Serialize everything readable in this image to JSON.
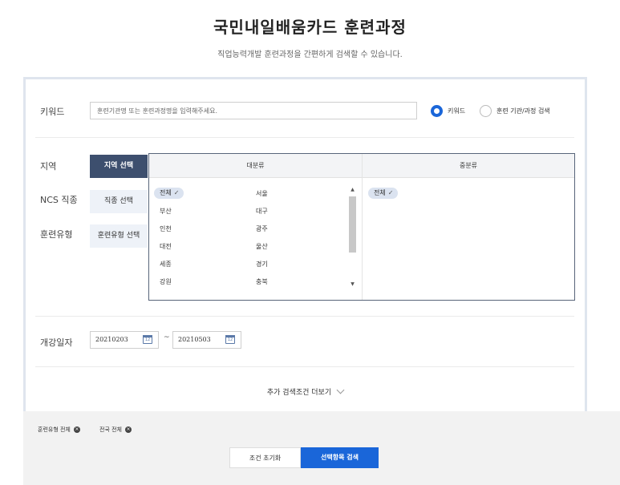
{
  "header": {
    "title": "국민내일배움카드 훈련과정",
    "subtitle": "직업능력개발 훈련과정을 간편하게 검색할 수 있습니다."
  },
  "keyword": {
    "label": "키워드",
    "placeholder": "훈련기관명 또는 훈련과정명을 입력해주세요.",
    "value": "",
    "radio_options": [
      {
        "label": "키워드",
        "selected": true
      },
      {
        "label": "훈련 기관/과정 검색",
        "selected": false
      }
    ]
  },
  "categories": [
    {
      "label": "지역",
      "button": "지역 선택",
      "active": true
    },
    {
      "label": "NCS 직종",
      "button": "직종 선택",
      "active": false
    },
    {
      "label": "훈련유형",
      "button": "훈련유형 선택",
      "active": false
    }
  ],
  "picker": {
    "col_major": "대분류",
    "col_minor": "중분류",
    "regions": [
      "전체",
      "서울",
      "부산",
      "대구",
      "인천",
      "광주",
      "대전",
      "울산",
      "세종",
      "경기",
      "강원",
      "충북"
    ],
    "selected_region": "전체",
    "minor_selected": "전체",
    "check_icon": "check-icon"
  },
  "date": {
    "label": "개강일자",
    "start": "20210203",
    "end": "20210503",
    "separator": "~",
    "calendar_icon_text": "12"
  },
  "more_conditions": "추가 검색조건 더보기",
  "selected_tags": [
    "훈련유형 전체",
    "전국 전체"
  ],
  "tag_remove_glyph": "×",
  "buttons": {
    "reset": "조건 초기화",
    "search": "선택항목 검색"
  },
  "colors": {
    "primary": "#1a66d9",
    "active_tab": "#3d4f6e",
    "chip": "#dbe3f0"
  }
}
